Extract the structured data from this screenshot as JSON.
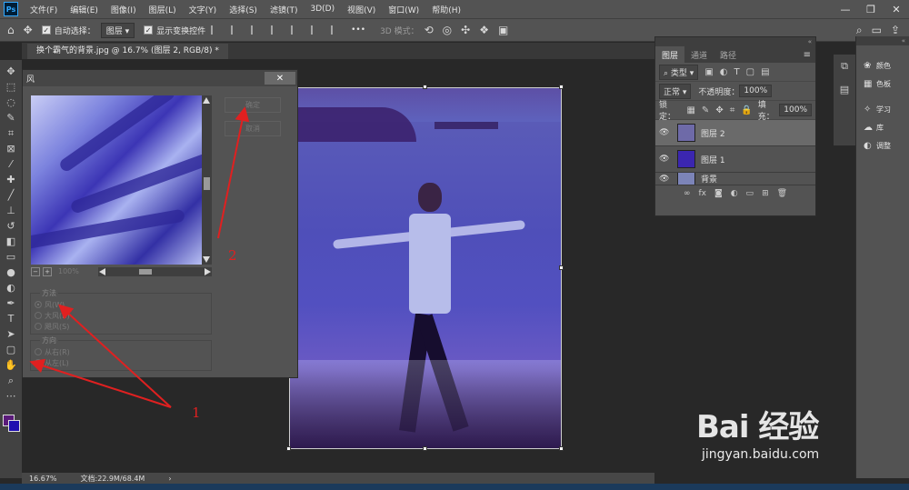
{
  "menubar": {
    "logo": "Ps",
    "items": [
      "文件(F)",
      "编辑(E)",
      "图像(I)",
      "图层(L)",
      "文字(Y)",
      "选择(S)",
      "滤镜(T)",
      "3D(D)",
      "视图(V)",
      "窗口(W)",
      "帮助(H)"
    ],
    "minimize": "—",
    "maximize": "❐",
    "close": "✕"
  },
  "options": {
    "auto_select_label": "自动选择：",
    "auto_select_value": "图层",
    "show_transform_label": "显示变换控件",
    "more": "•••",
    "mode_3d_label": "3D 模式："
  },
  "document": {
    "tab_title": "换个霸气的背景.jpg @ 16.7% (图层 2, RGB/8) *",
    "tab_close": "✕"
  },
  "dialog": {
    "title": "风",
    "close": "✕",
    "ok_label": "确定",
    "cancel_label": "取消",
    "zoom_minus": "−",
    "zoom_plus": "+",
    "zoom_value": "100%",
    "method_title": "方法",
    "method_options": [
      "风(W)",
      "大风(B)",
      "飓风(S)"
    ],
    "method_selected": 0,
    "direction_title": "方向",
    "direction_options": [
      "从右(R)",
      "从左(L)"
    ],
    "direction_selected": 1
  },
  "layers_panel": {
    "collapse": "«",
    "tabs": [
      "图层",
      "通道",
      "路径"
    ],
    "active_tab": 0,
    "menu": "≡",
    "filter_value": "类型",
    "blend_mode": "正常",
    "opacity_label": "不透明度：",
    "opacity_value": "100%",
    "lock_label": "锁定：",
    "fill_label": "填充：",
    "fill_value": "100%",
    "layers": [
      {
        "name": "图层 2",
        "selected": true,
        "thumb": "#6e6aa8"
      },
      {
        "name": "图层 1",
        "selected": false,
        "thumb": "#3b26b0"
      },
      {
        "name": "背景",
        "selected": false,
        "thumb": "#7c84b8"
      }
    ]
  },
  "side_panel": {
    "items": [
      {
        "icon": "color-icon",
        "label": "颜色"
      },
      {
        "icon": "swatches-icon",
        "label": "色板"
      },
      {
        "icon": "learn-icon",
        "label": "学习"
      },
      {
        "icon": "library-icon",
        "label": "库"
      },
      {
        "icon": "adjust-icon",
        "label": "调整"
      }
    ]
  },
  "status": {
    "zoom": "16.67%",
    "doc_size": "文档:22.9M/68.4M",
    "chevron": "›"
  },
  "annotations": {
    "label_1": "1",
    "label_2": "2"
  },
  "watermark": {
    "brand": "Bai 经验",
    "url": "jingyan.baidu.com"
  },
  "colors": {
    "foreground": "#5a1b7a",
    "background": "#1f0fb0",
    "annotation": "#e02020"
  }
}
